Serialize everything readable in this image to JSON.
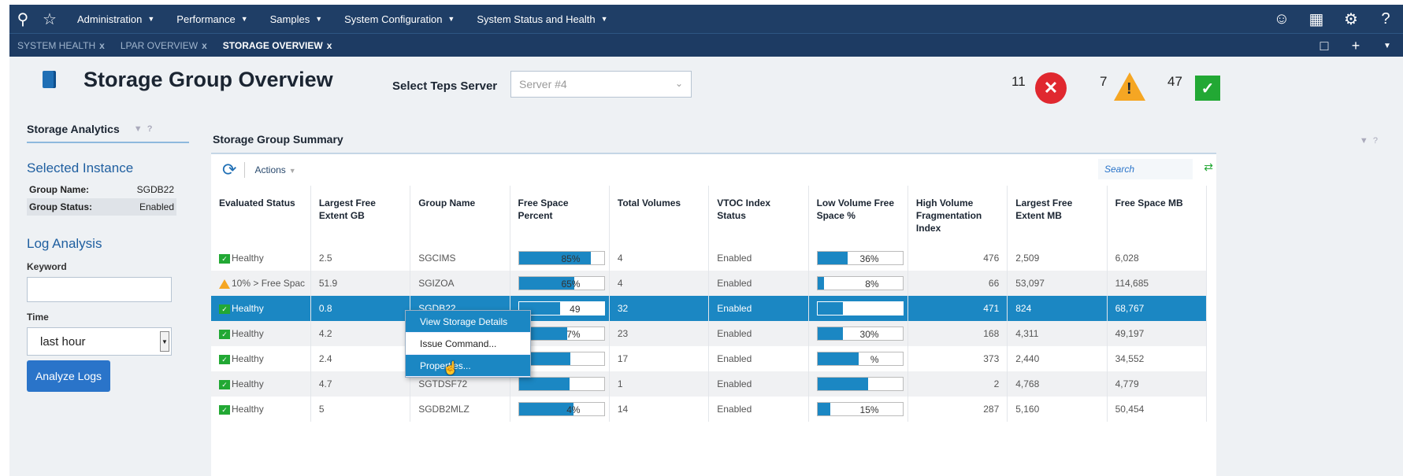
{
  "nav": {
    "menu": [
      "Administration",
      "Performance",
      "Samples",
      "System Configuration",
      "System Status and Health"
    ],
    "icons_left": [
      "search-icon",
      "star-icon"
    ],
    "icons_right": [
      "user-icon",
      "apps-grid-icon",
      "gear-icon",
      "help-icon"
    ]
  },
  "tabs": [
    {
      "label": "SYSTEM HEALTH",
      "active": false
    },
    {
      "label": "LPAR OVERVIEW",
      "active": false
    },
    {
      "label": "STORAGE OVERVIEW",
      "active": true
    }
  ],
  "header": {
    "title": "Storage Group Overview",
    "teps_label": "Select Teps Server",
    "teps_value": "Server #4"
  },
  "status_counts": {
    "critical": "11",
    "warning": "7",
    "ok": "47",
    "colors": {
      "critical": "#e0282f",
      "warning": "#f5a623",
      "ok": "#22a834"
    }
  },
  "left": {
    "analytics_title": "Storage Analytics",
    "selected_instance_title": "Selected Instance",
    "group_name_label": "Group Name:",
    "group_name_value": "SGDB22",
    "group_status_label": "Group Status:",
    "group_status_value": "Enabled",
    "log_title": "Log Analysis",
    "keyword_label": "Keyword",
    "keyword_value": "",
    "time_label": "Time",
    "time_value": "last hour",
    "analyze_button": "Analyze Logs"
  },
  "main": {
    "title": "Storage Group Summary",
    "actions_label": "Actions",
    "search_placeholder": "Search",
    "columns": [
      "Evaluated Status",
      "Largest Free Extent GB",
      "Group Name",
      "Free Space Percent",
      "Total Volumes",
      "VTOC Index Status",
      "Low Volume Free Space %",
      "High Volume Fragmentation Index",
      "Largest Free Extent MB",
      "Free Space MB"
    ],
    "rows": [
      {
        "status": "Healthy",
        "status_type": "ok",
        "lfe_gb": "2.5",
        "group": "SGCIMS",
        "free_pct": 0.85,
        "free_label": "85%",
        "volumes": "4",
        "vtoc": "Enabled",
        "low_pct": 0.36,
        "low_label": "36%",
        "frag": "476",
        "lfe_mb": "2,509",
        "free_mb": "6,028",
        "selected": false
      },
      {
        "status": "10% > Free Spac",
        "status_type": "warn",
        "lfe_gb": "51.9",
        "group": "SGIZOA",
        "free_pct": 0.65,
        "free_label": "65%",
        "volumes": "4",
        "vtoc": "Enabled",
        "low_pct": 0.08,
        "low_label": "8%",
        "frag": "66",
        "lfe_mb": "53,097",
        "free_mb": "114,685",
        "selected": false
      },
      {
        "status": "Healthy",
        "status_type": "ok",
        "lfe_gb": "0.8",
        "group": "SGDB22",
        "free_pct": 0.49,
        "free_label": "49",
        "volumes": "32",
        "vtoc": "Enabled",
        "low_pct": 0.3,
        "low_label": "",
        "frag": "471",
        "lfe_mb": "824",
        "free_mb": "68,767",
        "selected": true
      },
      {
        "status": "Healthy",
        "status_type": "ok",
        "lfe_gb": "4.2",
        "group": "",
        "free_pct": 0.57,
        "free_label": "7%",
        "volumes": "23",
        "vtoc": "Enabled",
        "low_pct": 0.3,
        "low_label": "30%",
        "frag": "168",
        "lfe_mb": "4,311",
        "free_mb": "49,197",
        "selected": false
      },
      {
        "status": "Healthy",
        "status_type": "ok",
        "lfe_gb": "2.4",
        "group": "",
        "free_pct": 0.61,
        "free_label": "",
        "volumes": "17",
        "vtoc": "Enabled",
        "low_pct": 0.49,
        "low_label": "%",
        "frag": "373",
        "lfe_mb": "2,440",
        "free_mb": "34,552",
        "selected": false
      },
      {
        "status": "Healthy",
        "status_type": "ok",
        "lfe_gb": "4.7",
        "group": "SGTDSF72",
        "free_pct": 0.6,
        "free_label": "",
        "volumes": "1",
        "vtoc": "Enabled",
        "low_pct": 0.6,
        "low_label": "",
        "frag": "2",
        "lfe_mb": "4,768",
        "free_mb": "4,779",
        "selected": false
      },
      {
        "status": "Healthy",
        "status_type": "ok",
        "lfe_gb": "5",
        "group": "SGDB2MLZ",
        "free_pct": 0.64,
        "free_label": "4%",
        "volumes": "14",
        "vtoc": "Enabled",
        "low_pct": 0.15,
        "low_label": "15%",
        "frag": "287",
        "lfe_mb": "5,160",
        "free_mb": "50,454",
        "selected": false
      }
    ]
  },
  "context_menu": [
    "View Storage Details",
    "Issue Command...",
    "Properties..."
  ]
}
